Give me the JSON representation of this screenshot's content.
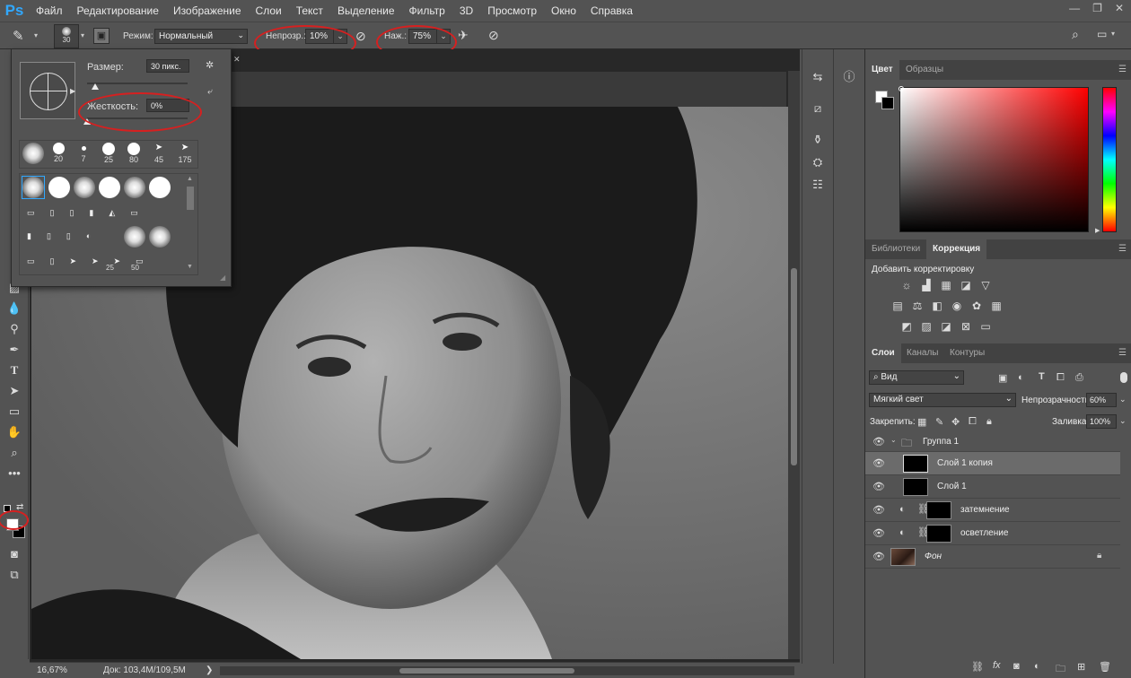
{
  "app": {
    "logo": "Ps"
  },
  "menu": [
    "Файл",
    "Редактирование",
    "Изображение",
    "Слои",
    "Текст",
    "Выделение",
    "Фильтр",
    "3D",
    "Просмотр",
    "Окно",
    "Справка"
  ],
  "window_controls": [
    "—",
    "❐",
    "✕"
  ],
  "options": {
    "brush_size_label": "30",
    "mode_label": "Режим:",
    "mode_value": "Нормальный",
    "opacity_label": "Непрозр.:",
    "opacity_value": "10%",
    "flow_label": "Наж.:",
    "flow_value": "75%"
  },
  "brush_popup": {
    "size_label": "Размер:",
    "size_value": "30 пикс.",
    "hardness_label": "Жесткость:",
    "hardness_value": "0%",
    "size_fraction": 0.08,
    "hardness_fraction": 0.0,
    "top_row_labels": [
      "",
      "20",
      "7",
      "25",
      "80",
      "45",
      "175"
    ],
    "grid_labels": [
      "25",
      "50"
    ]
  },
  "document": {
    "tab_close": "✕"
  },
  "status": {
    "zoom": "16,67%",
    "doc_info": "Док: 103,4M/109,5M",
    "arrow": "❯"
  },
  "color_panel": {
    "tab_color": "Цвет",
    "tab_swatches": "Образцы"
  },
  "adjust_panel": {
    "tab_libraries": "Библиотеки",
    "tab_correction": "Коррекция",
    "add_label": "Добавить корректировку"
  },
  "layers_panel": {
    "tab_layers": "Слои",
    "tab_channels": "Каналы",
    "tab_paths": "Контуры",
    "filter_label": "Вид",
    "blend_mode": "Мягкий свет",
    "opacity_label": "Непрозрачность:",
    "opacity_value": "60%",
    "lock_label": "Закрепить:",
    "fill_label": "Заливка:",
    "fill_value": "100%",
    "layers": [
      {
        "name": "Группа 1"
      },
      {
        "name": "Слой 1 копия"
      },
      {
        "name": "Слой 1"
      },
      {
        "name": "затемнение"
      },
      {
        "name": "осветление"
      },
      {
        "name": "Фон"
      }
    ]
  },
  "colors": {
    "accent": "#31a8ff",
    "annotation_red": "#d62020",
    "selected_row": "#6b6b6b"
  }
}
